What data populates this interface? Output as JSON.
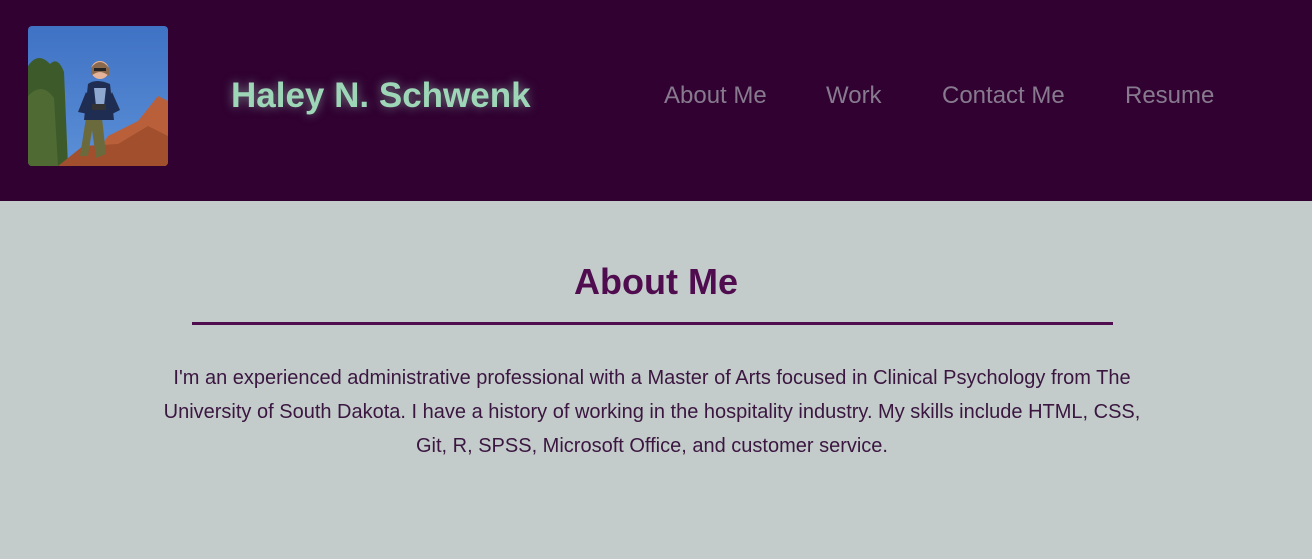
{
  "header": {
    "site_name": "Haley N. Schwenk",
    "nav": [
      {
        "label": "About Me"
      },
      {
        "label": "Work"
      },
      {
        "label": "Contact Me"
      },
      {
        "label": "Resume"
      }
    ]
  },
  "about": {
    "title": "About Me",
    "bio": "I'm an experienced administrative professional with a Master of Arts focused in Clinical Psychology from The University of South Dakota. I have a history of working in the hospitality industry. My skills include HTML, CSS, Git, R, SPSS, Microsoft Office, and customer service."
  },
  "colors": {
    "header_bg": "#300131",
    "page_bg": "#c4cccb",
    "site_name": "#9ed6b8",
    "nav_link": "#877a8f",
    "accent": "#4f0d4f"
  }
}
